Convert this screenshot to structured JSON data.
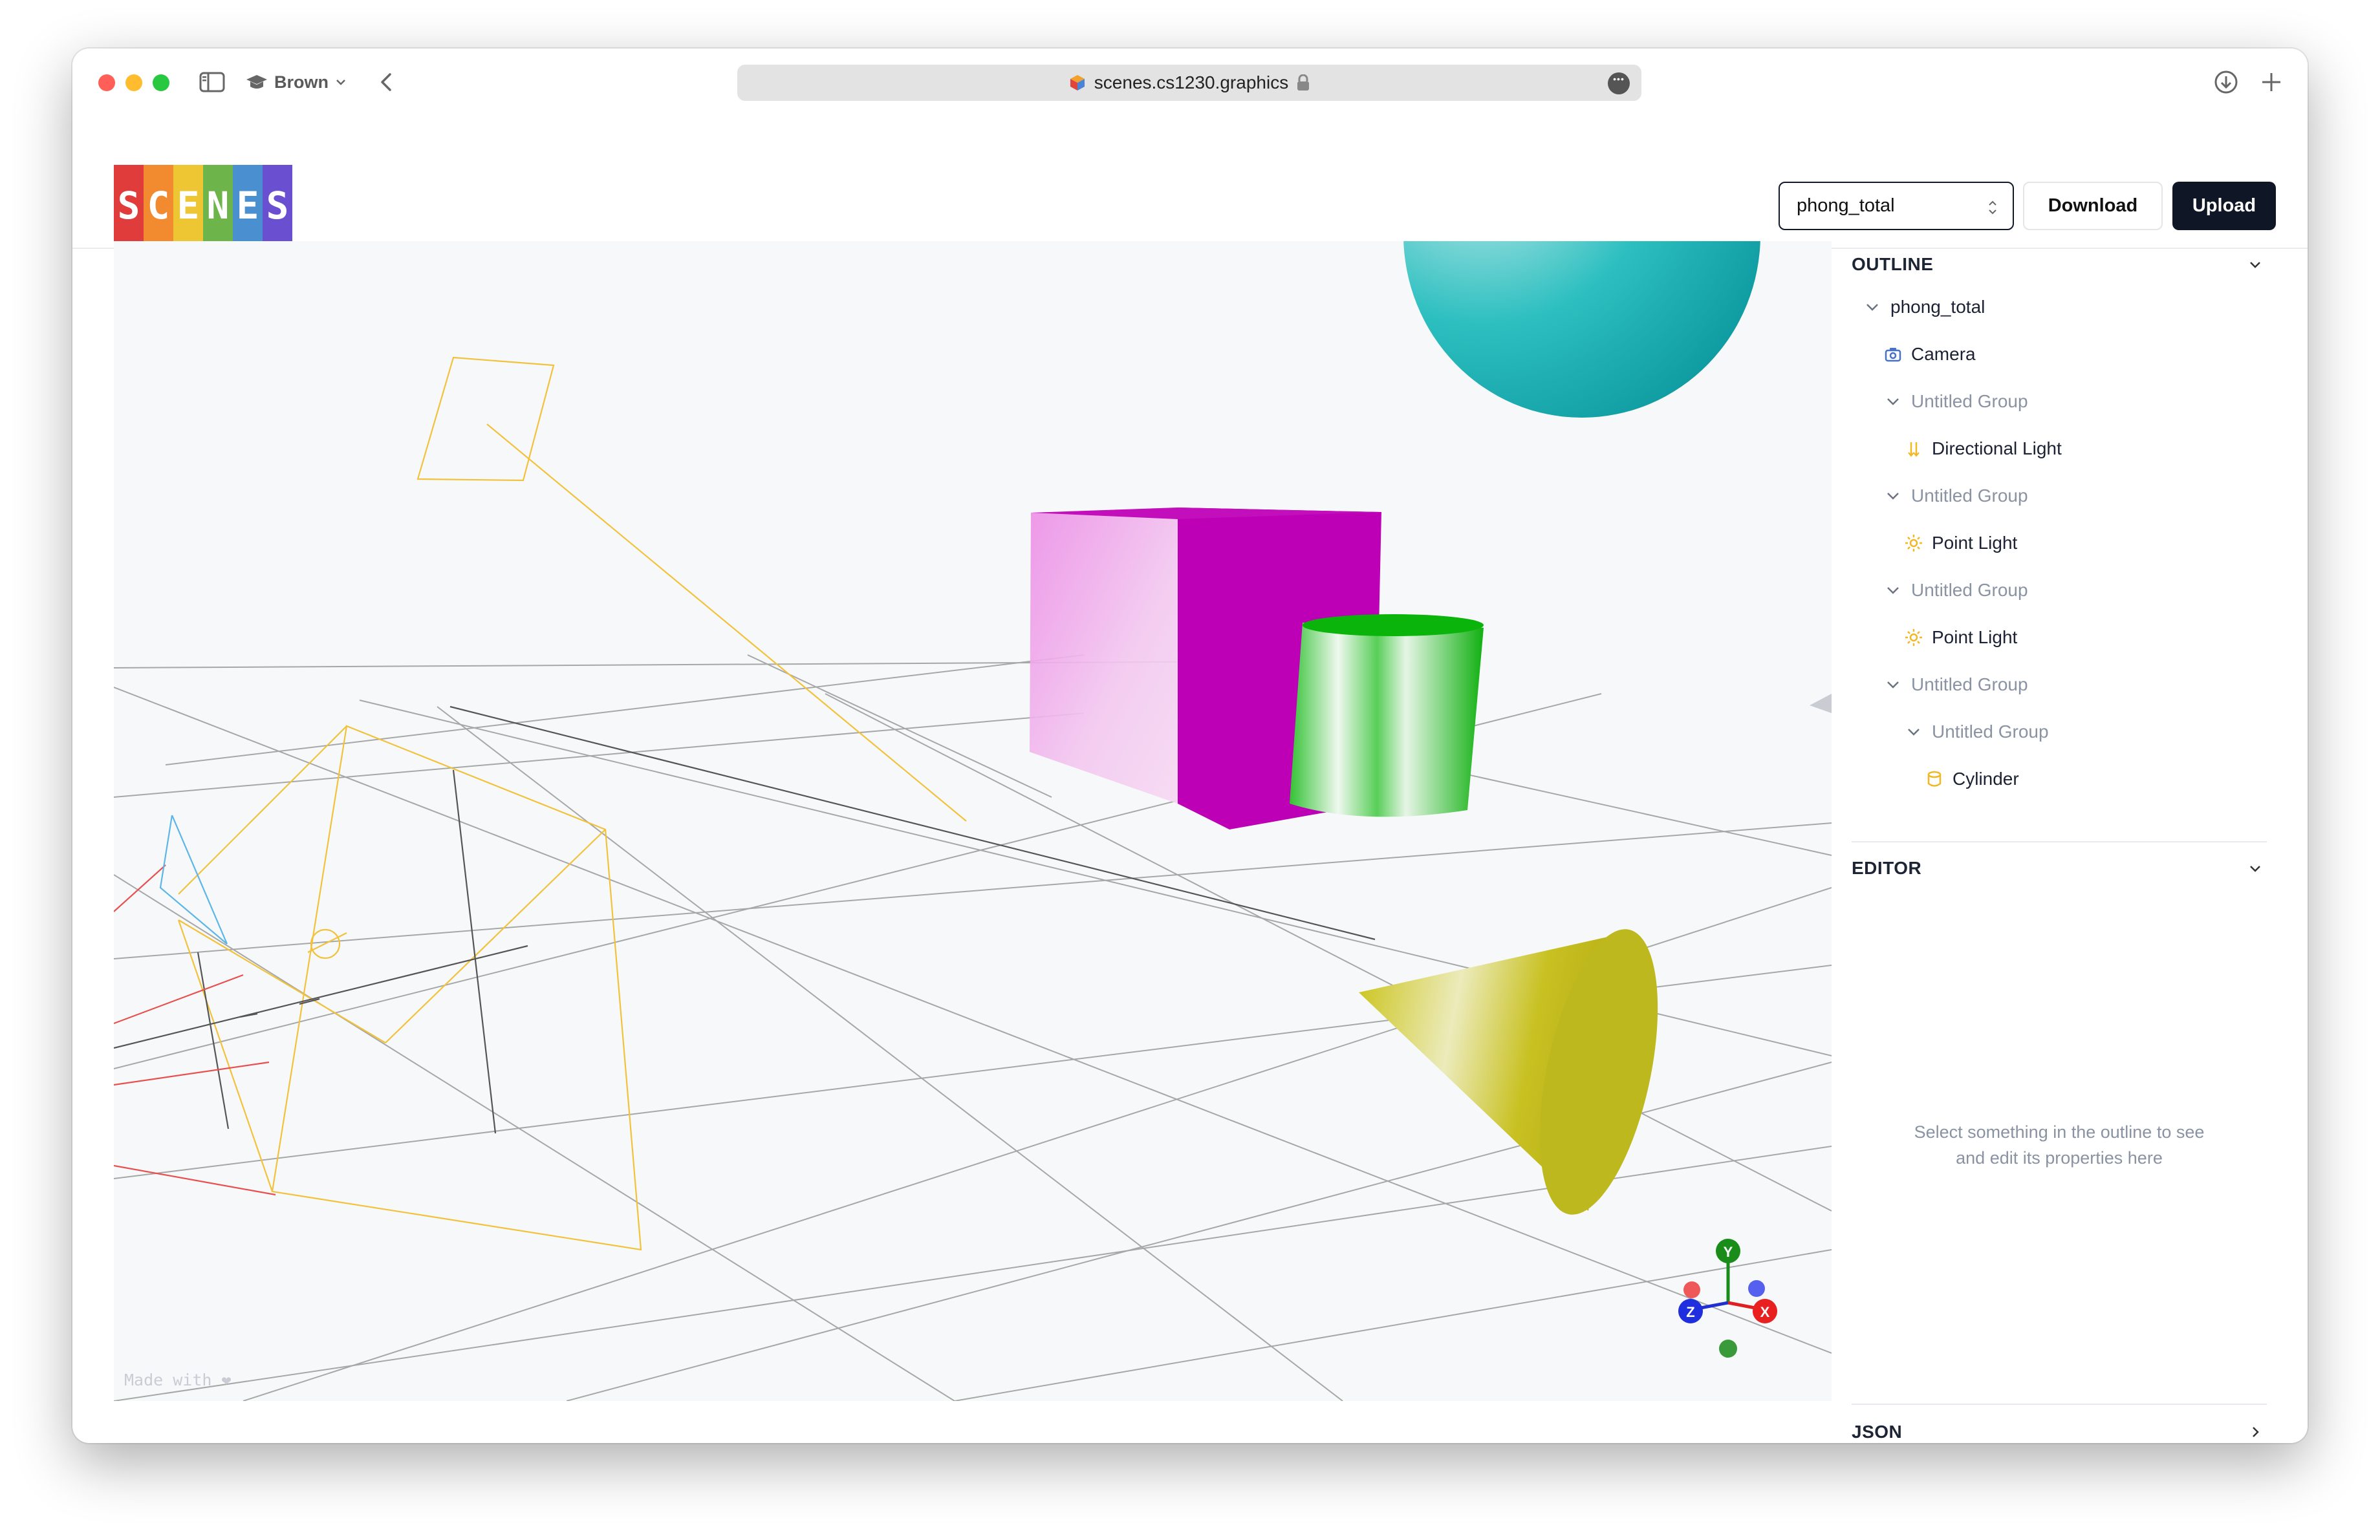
{
  "browser": {
    "profile_label": "Brown",
    "url": "scenes.cs1230.graphics"
  },
  "header": {
    "logo_letters": [
      "S",
      "C",
      "E",
      "N",
      "E",
      "S"
    ],
    "logo_colors": [
      "#e03c3c",
      "#f28b30",
      "#eec533",
      "#6db54b",
      "#4a90d0",
      "#6a4fd1"
    ],
    "scene_select_value": "phong_total",
    "download_label": "Download",
    "upload_label": "Upload"
  },
  "viewport": {
    "made_with": "Made with ❤",
    "axes": {
      "y": "Y",
      "x": "X",
      "z": "Z"
    }
  },
  "outline": {
    "title": "OUTLINE",
    "items": [
      {
        "label": "phong_total",
        "icon": "chevron-down-icon",
        "muted": false
      },
      {
        "label": "Camera",
        "icon": "camera-icon",
        "muted": false
      },
      {
        "label": "Untitled Group",
        "icon": "chevron-down-icon",
        "muted": true
      },
      {
        "label": "Directional Light",
        "icon": "directional-light-icon",
        "muted": false
      },
      {
        "label": "Untitled Group",
        "icon": "chevron-down-icon",
        "muted": true
      },
      {
        "label": "Point Light",
        "icon": "sun-icon",
        "muted": false
      },
      {
        "label": "Untitled Group",
        "icon": "chevron-down-icon",
        "muted": true
      },
      {
        "label": "Point Light",
        "icon": "sun-icon",
        "muted": false
      },
      {
        "label": "Untitled Group",
        "icon": "chevron-down-icon",
        "muted": true
      },
      {
        "label": "Untitled Group",
        "icon": "chevron-down-icon",
        "muted": true
      },
      {
        "label": "Cylinder",
        "icon": "cylinder-icon",
        "muted": false
      }
    ]
  },
  "editor": {
    "title": "EDITOR",
    "empty_line1": "Select something in the outline to see",
    "empty_line2": "and edit its properties here"
  },
  "json_section": {
    "title": "JSON"
  },
  "colors": {
    "accent_dark": "#0f1626",
    "light_icon": "#f1b824",
    "camera_icon": "#4673c9"
  }
}
